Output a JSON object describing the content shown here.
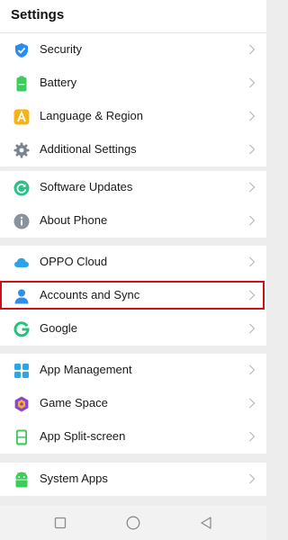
{
  "header": {
    "title": "Settings"
  },
  "groups": [
    {
      "items": [
        {
          "label": "Security",
          "icon": "shield-icon",
          "color": "#2b8cf0"
        },
        {
          "label": "Battery",
          "icon": "battery-icon",
          "color": "#3dcc5c"
        },
        {
          "label": "Language & Region",
          "icon": "language-icon",
          "color": "#f5b21b"
        },
        {
          "label": "Additional Settings",
          "icon": "gear-icon",
          "color": "#7a8491"
        }
      ]
    },
    {
      "items": [
        {
          "label": "Software Updates",
          "icon": "update-icon",
          "color": "#2cc08a"
        },
        {
          "label": "About Phone",
          "icon": "info-icon",
          "color": "#8a929c"
        }
      ]
    },
    {
      "items": [
        {
          "label": "OPPO Cloud",
          "icon": "cloud-icon",
          "color": "#2aa6e8"
        },
        {
          "label": "Accounts and Sync",
          "icon": "person-icon",
          "color": "#2f8fe6"
        },
        {
          "label": "Google",
          "icon": "google-g-icon",
          "color": "#25c27a"
        }
      ]
    },
    {
      "items": [
        {
          "label": "App Management",
          "icon": "apps-grid-icon",
          "color": "#2aa6e8"
        },
        {
          "label": "Game Space",
          "icon": "game-space-icon",
          "color": "#8a45d6"
        },
        {
          "label": "App Split-screen",
          "icon": "split-screen-icon",
          "color": "#3dcc5c"
        }
      ]
    },
    {
      "items": [
        {
          "label": "System Apps",
          "icon": "android-icon",
          "color": "#3dcc5c"
        }
      ]
    }
  ],
  "highlight": {
    "item": "Accounts and Sync",
    "color": "#c8121a"
  },
  "navbar": {
    "buttons": [
      {
        "icon": "recents-square-icon"
      },
      {
        "icon": "home-circle-icon"
      },
      {
        "icon": "back-triangle-icon"
      }
    ]
  }
}
